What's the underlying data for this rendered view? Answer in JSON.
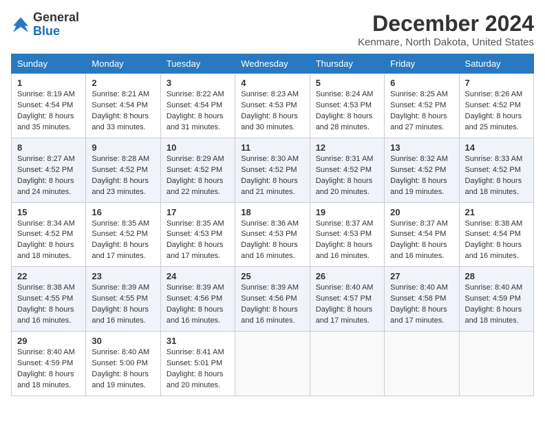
{
  "header": {
    "logo_general": "General",
    "logo_blue": "Blue",
    "month_title": "December 2024",
    "location": "Kenmare, North Dakota, United States"
  },
  "days_of_week": [
    "Sunday",
    "Monday",
    "Tuesday",
    "Wednesday",
    "Thursday",
    "Friday",
    "Saturday"
  ],
  "weeks": [
    [
      {
        "day": "1",
        "sunrise": "8:19 AM",
        "sunset": "4:54 PM",
        "daylight": "8 hours and 35 minutes."
      },
      {
        "day": "2",
        "sunrise": "8:21 AM",
        "sunset": "4:54 PM",
        "daylight": "8 hours and 33 minutes."
      },
      {
        "day": "3",
        "sunrise": "8:22 AM",
        "sunset": "4:54 PM",
        "daylight": "8 hours and 31 minutes."
      },
      {
        "day": "4",
        "sunrise": "8:23 AM",
        "sunset": "4:53 PM",
        "daylight": "8 hours and 30 minutes."
      },
      {
        "day": "5",
        "sunrise": "8:24 AM",
        "sunset": "4:53 PM",
        "daylight": "8 hours and 28 minutes."
      },
      {
        "day": "6",
        "sunrise": "8:25 AM",
        "sunset": "4:52 PM",
        "daylight": "8 hours and 27 minutes."
      },
      {
        "day": "7",
        "sunrise": "8:26 AM",
        "sunset": "4:52 PM",
        "daylight": "8 hours and 25 minutes."
      }
    ],
    [
      {
        "day": "8",
        "sunrise": "8:27 AM",
        "sunset": "4:52 PM",
        "daylight": "8 hours and 24 minutes."
      },
      {
        "day": "9",
        "sunrise": "8:28 AM",
        "sunset": "4:52 PM",
        "daylight": "8 hours and 23 minutes."
      },
      {
        "day": "10",
        "sunrise": "8:29 AM",
        "sunset": "4:52 PM",
        "daylight": "8 hours and 22 minutes."
      },
      {
        "day": "11",
        "sunrise": "8:30 AM",
        "sunset": "4:52 PM",
        "daylight": "8 hours and 21 minutes."
      },
      {
        "day": "12",
        "sunrise": "8:31 AM",
        "sunset": "4:52 PM",
        "daylight": "8 hours and 20 minutes."
      },
      {
        "day": "13",
        "sunrise": "8:32 AM",
        "sunset": "4:52 PM",
        "daylight": "8 hours and 19 minutes."
      },
      {
        "day": "14",
        "sunrise": "8:33 AM",
        "sunset": "4:52 PM",
        "daylight": "8 hours and 18 minutes."
      }
    ],
    [
      {
        "day": "15",
        "sunrise": "8:34 AM",
        "sunset": "4:52 PM",
        "daylight": "8 hours and 18 minutes."
      },
      {
        "day": "16",
        "sunrise": "8:35 AM",
        "sunset": "4:52 PM",
        "daylight": "8 hours and 17 minutes."
      },
      {
        "day": "17",
        "sunrise": "8:35 AM",
        "sunset": "4:53 PM",
        "daylight": "8 hours and 17 minutes."
      },
      {
        "day": "18",
        "sunrise": "8:36 AM",
        "sunset": "4:53 PM",
        "daylight": "8 hours and 16 minutes."
      },
      {
        "day": "19",
        "sunrise": "8:37 AM",
        "sunset": "4:53 PM",
        "daylight": "8 hours and 16 minutes."
      },
      {
        "day": "20",
        "sunrise": "8:37 AM",
        "sunset": "4:54 PM",
        "daylight": "8 hours and 16 minutes."
      },
      {
        "day": "21",
        "sunrise": "8:38 AM",
        "sunset": "4:54 PM",
        "daylight": "8 hours and 16 minutes."
      }
    ],
    [
      {
        "day": "22",
        "sunrise": "8:38 AM",
        "sunset": "4:55 PM",
        "daylight": "8 hours and 16 minutes."
      },
      {
        "day": "23",
        "sunrise": "8:39 AM",
        "sunset": "4:55 PM",
        "daylight": "8 hours and 16 minutes."
      },
      {
        "day": "24",
        "sunrise": "8:39 AM",
        "sunset": "4:56 PM",
        "daylight": "8 hours and 16 minutes."
      },
      {
        "day": "25",
        "sunrise": "8:39 AM",
        "sunset": "4:56 PM",
        "daylight": "8 hours and 16 minutes."
      },
      {
        "day": "26",
        "sunrise": "8:40 AM",
        "sunset": "4:57 PM",
        "daylight": "8 hours and 17 minutes."
      },
      {
        "day": "27",
        "sunrise": "8:40 AM",
        "sunset": "4:58 PM",
        "daylight": "8 hours and 17 minutes."
      },
      {
        "day": "28",
        "sunrise": "8:40 AM",
        "sunset": "4:59 PM",
        "daylight": "8 hours and 18 minutes."
      }
    ],
    [
      {
        "day": "29",
        "sunrise": "8:40 AM",
        "sunset": "4:59 PM",
        "daylight": "8 hours and 18 minutes."
      },
      {
        "day": "30",
        "sunrise": "8:40 AM",
        "sunset": "5:00 PM",
        "daylight": "8 hours and 19 minutes."
      },
      {
        "day": "31",
        "sunrise": "8:41 AM",
        "sunset": "5:01 PM",
        "daylight": "8 hours and 20 minutes."
      },
      null,
      null,
      null,
      null
    ]
  ],
  "labels": {
    "sunrise_prefix": "Sunrise: ",
    "sunset_prefix": "Sunset: ",
    "daylight_prefix": "Daylight: "
  }
}
